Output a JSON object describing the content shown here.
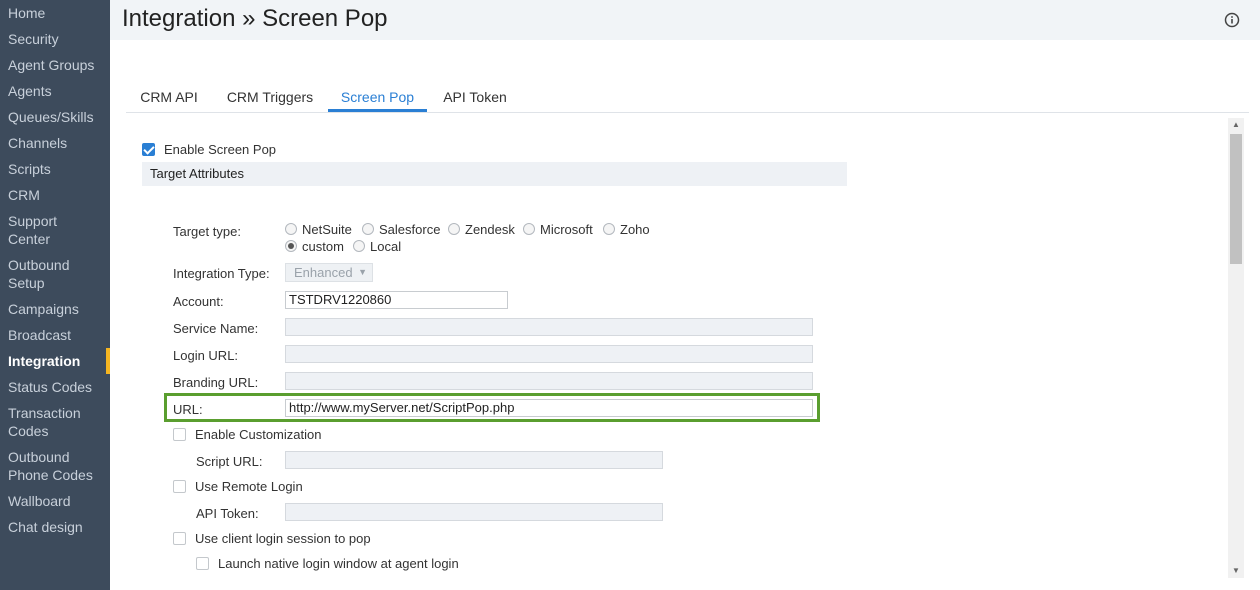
{
  "sidebar": {
    "items": [
      {
        "label": "Home"
      },
      {
        "label": "Security"
      },
      {
        "label": "Agent Groups"
      },
      {
        "label": "Agents"
      },
      {
        "label": "Queues/Skills"
      },
      {
        "label": "Channels"
      },
      {
        "label": "Scripts"
      },
      {
        "label": "CRM"
      },
      {
        "label": "Support",
        "label2": "Center"
      },
      {
        "label": "Outbound",
        "label2": "Setup"
      },
      {
        "label": "Campaigns"
      },
      {
        "label": "Broadcast"
      },
      {
        "label": "Integration",
        "active": true
      },
      {
        "label": "Status Codes"
      },
      {
        "label": "Transaction",
        "label2": "Codes"
      },
      {
        "label": "Outbound",
        "label2": "Phone Codes"
      },
      {
        "label": "Wallboard"
      },
      {
        "label": "Chat design"
      }
    ]
  },
  "header": {
    "title": "Integration » Screen Pop",
    "info_icon": "info-icon"
  },
  "tabs": [
    {
      "label": "CRM API"
    },
    {
      "label": "CRM Triggers"
    },
    {
      "label": "Screen Pop",
      "active": true
    },
    {
      "label": "API Token"
    }
  ],
  "form": {
    "enable_screen_pop": {
      "label": "Enable Screen Pop",
      "checked": true
    },
    "section_title": "Target Attributes",
    "target_type": {
      "label": "Target type:",
      "options": [
        "NetSuite",
        "Salesforce",
        "Zendesk",
        "Microsoft",
        "Zoho",
        "custom",
        "Local"
      ],
      "selected": "custom"
    },
    "integration_type": {
      "label": "Integration Type:",
      "value": "Enhanced"
    },
    "account": {
      "label": "Account:",
      "value": "TSTDRV1220860"
    },
    "service_name": {
      "label": "Service Name:",
      "value": ""
    },
    "login_url": {
      "label": "Login URL:",
      "value": ""
    },
    "branding_url": {
      "label": "Branding URL:",
      "value": ""
    },
    "url": {
      "label": "URL:",
      "value": "http://www.myServer.net/ScriptPop.php"
    },
    "enable_customization": {
      "label": "Enable Customization",
      "checked": false
    },
    "script_url": {
      "label": "Script URL:",
      "value": ""
    },
    "use_remote_login": {
      "label": "Use Remote Login",
      "checked": false
    },
    "api_token": {
      "label": "API Token:",
      "value": ""
    },
    "use_client_login": {
      "label": "Use client login session to pop",
      "checked": false
    },
    "launch_native": {
      "label": "Launch native login window at agent login",
      "checked": false
    }
  },
  "colors": {
    "sidebar_bg": "#3d4b5c",
    "accent": "#2a7fd4",
    "active_marker": "#f5b521",
    "highlight": "#5a9e2f"
  }
}
